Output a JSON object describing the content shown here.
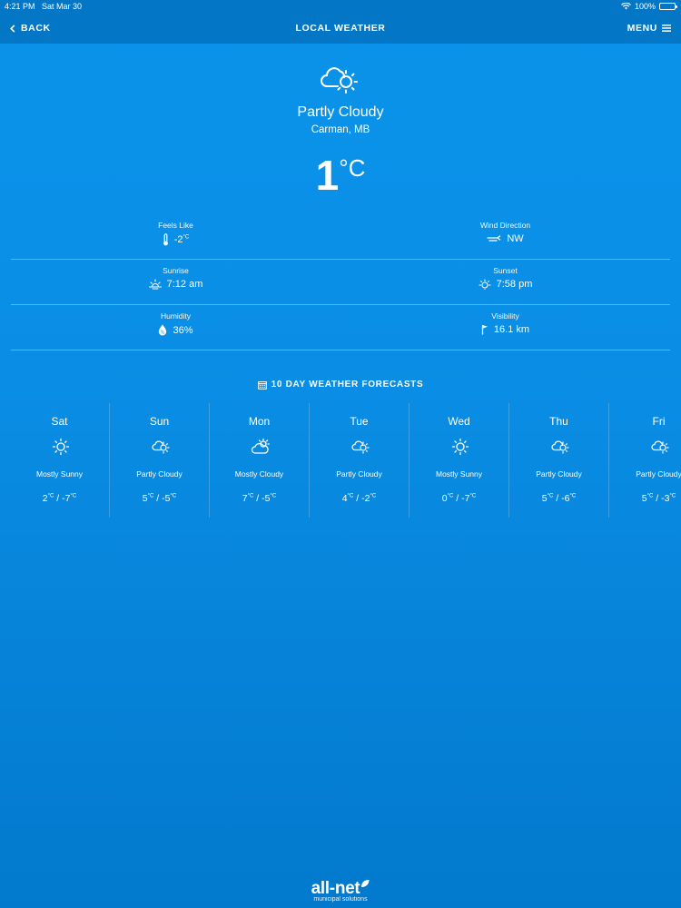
{
  "status": {
    "time": "4:21 PM",
    "date": "Sat Mar 30",
    "battery": "100%"
  },
  "nav": {
    "back": "BACK",
    "title": "LOCAL WEATHER",
    "menu": "MENU"
  },
  "current": {
    "icon": "partly-cloudy-icon",
    "condition": "Partly Cloudy",
    "location": "Carman, MB",
    "temp": "1",
    "unit": "°C"
  },
  "details": {
    "feels_like": {
      "label": "Feels Like",
      "value": "-2",
      "unit": "°C"
    },
    "wind_direction": {
      "label": "Wind Direction",
      "value": "NW"
    },
    "sunrise": {
      "label": "Sunrise",
      "value": "7:12 am"
    },
    "sunset": {
      "label": "Sunset",
      "value": "7:58 pm"
    },
    "humidity": {
      "label": "Humidity",
      "value": "36%"
    },
    "visibility": {
      "label": "Visibility",
      "value": "16.1 km"
    }
  },
  "forecast": {
    "title": "10 DAY WEATHER FORECASTS",
    "days": [
      {
        "day": "Sat",
        "icon": "sunny-icon",
        "condition": "Mostly Sunny",
        "high": "2",
        "low": "-7",
        "unit": "°C"
      },
      {
        "day": "Sun",
        "icon": "partly-cloudy-icon",
        "condition": "Partly Cloudy",
        "high": "5",
        "low": "-5",
        "unit": "°C"
      },
      {
        "day": "Mon",
        "icon": "mostly-cloudy-icon",
        "condition": "Mostly Cloudy",
        "high": "7",
        "low": "-5",
        "unit": "°C"
      },
      {
        "day": "Tue",
        "icon": "partly-cloudy-icon",
        "condition": "Partly Cloudy",
        "high": "4",
        "low": "-2",
        "unit": "°C"
      },
      {
        "day": "Wed",
        "icon": "sunny-icon",
        "condition": "Mostly Sunny",
        "high": "0",
        "low": "-7",
        "unit": "°C"
      },
      {
        "day": "Thu",
        "icon": "partly-cloudy-icon",
        "condition": "Partly Cloudy",
        "high": "5",
        "low": "-6",
        "unit": "°C"
      },
      {
        "day": "Fri",
        "icon": "partly-cloudy-icon",
        "condition": "Partly Cloudy",
        "high": "5",
        "low": "-3",
        "unit": "°C"
      }
    ]
  },
  "logo": {
    "brand": "all-net",
    "tagline": "municipal solutions"
  }
}
